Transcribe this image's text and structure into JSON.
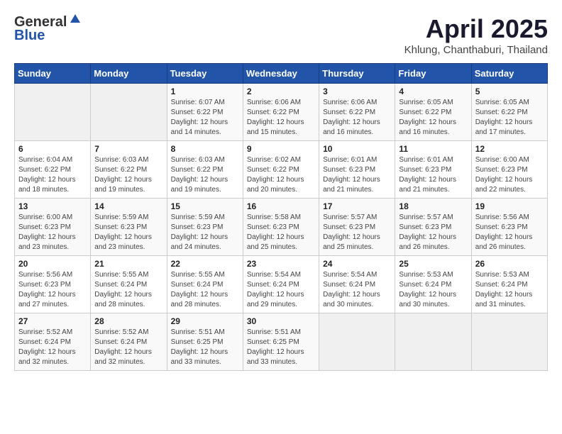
{
  "header": {
    "logo_general": "General",
    "logo_blue": "Blue",
    "title": "April 2025",
    "subtitle": "Khlung, Chanthaburi, Thailand"
  },
  "weekdays": [
    "Sunday",
    "Monday",
    "Tuesday",
    "Wednesday",
    "Thursday",
    "Friday",
    "Saturday"
  ],
  "weeks": [
    [
      {
        "num": "",
        "lines": []
      },
      {
        "num": "",
        "lines": []
      },
      {
        "num": "1",
        "lines": [
          "Sunrise: 6:07 AM",
          "Sunset: 6:22 PM",
          "Daylight: 12 hours",
          "and 14 minutes."
        ]
      },
      {
        "num": "2",
        "lines": [
          "Sunrise: 6:06 AM",
          "Sunset: 6:22 PM",
          "Daylight: 12 hours",
          "and 15 minutes."
        ]
      },
      {
        "num": "3",
        "lines": [
          "Sunrise: 6:06 AM",
          "Sunset: 6:22 PM",
          "Daylight: 12 hours",
          "and 16 minutes."
        ]
      },
      {
        "num": "4",
        "lines": [
          "Sunrise: 6:05 AM",
          "Sunset: 6:22 PM",
          "Daylight: 12 hours",
          "and 16 minutes."
        ]
      },
      {
        "num": "5",
        "lines": [
          "Sunrise: 6:05 AM",
          "Sunset: 6:22 PM",
          "Daylight: 12 hours",
          "and 17 minutes."
        ]
      }
    ],
    [
      {
        "num": "6",
        "lines": [
          "Sunrise: 6:04 AM",
          "Sunset: 6:22 PM",
          "Daylight: 12 hours",
          "and 18 minutes."
        ]
      },
      {
        "num": "7",
        "lines": [
          "Sunrise: 6:03 AM",
          "Sunset: 6:22 PM",
          "Daylight: 12 hours",
          "and 19 minutes."
        ]
      },
      {
        "num": "8",
        "lines": [
          "Sunrise: 6:03 AM",
          "Sunset: 6:22 PM",
          "Daylight: 12 hours",
          "and 19 minutes."
        ]
      },
      {
        "num": "9",
        "lines": [
          "Sunrise: 6:02 AM",
          "Sunset: 6:22 PM",
          "Daylight: 12 hours",
          "and 20 minutes."
        ]
      },
      {
        "num": "10",
        "lines": [
          "Sunrise: 6:01 AM",
          "Sunset: 6:23 PM",
          "Daylight: 12 hours",
          "and 21 minutes."
        ]
      },
      {
        "num": "11",
        "lines": [
          "Sunrise: 6:01 AM",
          "Sunset: 6:23 PM",
          "Daylight: 12 hours",
          "and 21 minutes."
        ]
      },
      {
        "num": "12",
        "lines": [
          "Sunrise: 6:00 AM",
          "Sunset: 6:23 PM",
          "Daylight: 12 hours",
          "and 22 minutes."
        ]
      }
    ],
    [
      {
        "num": "13",
        "lines": [
          "Sunrise: 6:00 AM",
          "Sunset: 6:23 PM",
          "Daylight: 12 hours",
          "and 23 minutes."
        ]
      },
      {
        "num": "14",
        "lines": [
          "Sunrise: 5:59 AM",
          "Sunset: 6:23 PM",
          "Daylight: 12 hours",
          "and 23 minutes."
        ]
      },
      {
        "num": "15",
        "lines": [
          "Sunrise: 5:59 AM",
          "Sunset: 6:23 PM",
          "Daylight: 12 hours",
          "and 24 minutes."
        ]
      },
      {
        "num": "16",
        "lines": [
          "Sunrise: 5:58 AM",
          "Sunset: 6:23 PM",
          "Daylight: 12 hours",
          "and 25 minutes."
        ]
      },
      {
        "num": "17",
        "lines": [
          "Sunrise: 5:57 AM",
          "Sunset: 6:23 PM",
          "Daylight: 12 hours",
          "and 25 minutes."
        ]
      },
      {
        "num": "18",
        "lines": [
          "Sunrise: 5:57 AM",
          "Sunset: 6:23 PM",
          "Daylight: 12 hours",
          "and 26 minutes."
        ]
      },
      {
        "num": "19",
        "lines": [
          "Sunrise: 5:56 AM",
          "Sunset: 6:23 PM",
          "Daylight: 12 hours",
          "and 26 minutes."
        ]
      }
    ],
    [
      {
        "num": "20",
        "lines": [
          "Sunrise: 5:56 AM",
          "Sunset: 6:23 PM",
          "Daylight: 12 hours",
          "and 27 minutes."
        ]
      },
      {
        "num": "21",
        "lines": [
          "Sunrise: 5:55 AM",
          "Sunset: 6:24 PM",
          "Daylight: 12 hours",
          "and 28 minutes."
        ]
      },
      {
        "num": "22",
        "lines": [
          "Sunrise: 5:55 AM",
          "Sunset: 6:24 PM",
          "Daylight: 12 hours",
          "and 28 minutes."
        ]
      },
      {
        "num": "23",
        "lines": [
          "Sunrise: 5:54 AM",
          "Sunset: 6:24 PM",
          "Daylight: 12 hours",
          "and 29 minutes."
        ]
      },
      {
        "num": "24",
        "lines": [
          "Sunrise: 5:54 AM",
          "Sunset: 6:24 PM",
          "Daylight: 12 hours",
          "and 30 minutes."
        ]
      },
      {
        "num": "25",
        "lines": [
          "Sunrise: 5:53 AM",
          "Sunset: 6:24 PM",
          "Daylight: 12 hours",
          "and 30 minutes."
        ]
      },
      {
        "num": "26",
        "lines": [
          "Sunrise: 5:53 AM",
          "Sunset: 6:24 PM",
          "Daylight: 12 hours",
          "and 31 minutes."
        ]
      }
    ],
    [
      {
        "num": "27",
        "lines": [
          "Sunrise: 5:52 AM",
          "Sunset: 6:24 PM",
          "Daylight: 12 hours",
          "and 32 minutes."
        ]
      },
      {
        "num": "28",
        "lines": [
          "Sunrise: 5:52 AM",
          "Sunset: 6:24 PM",
          "Daylight: 12 hours",
          "and 32 minutes."
        ]
      },
      {
        "num": "29",
        "lines": [
          "Sunrise: 5:51 AM",
          "Sunset: 6:25 PM",
          "Daylight: 12 hours",
          "and 33 minutes."
        ]
      },
      {
        "num": "30",
        "lines": [
          "Sunrise: 5:51 AM",
          "Sunset: 6:25 PM",
          "Daylight: 12 hours",
          "and 33 minutes."
        ]
      },
      {
        "num": "",
        "lines": []
      },
      {
        "num": "",
        "lines": []
      },
      {
        "num": "",
        "lines": []
      }
    ]
  ]
}
